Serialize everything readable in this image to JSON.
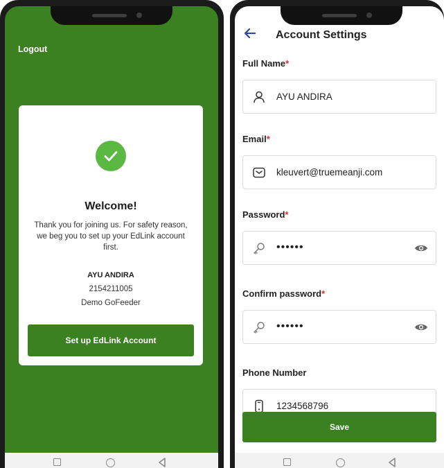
{
  "welcome_screen": {
    "logout_label": "Logout",
    "welcome_title": "Welcome!",
    "welcome_message": "Thank you for joining us. For safety reason, we beg you to set up your EdLink account first.",
    "user_name": "AYU ANDIRA",
    "user_id": "2154211005",
    "organization": "Demo GoFeeder",
    "setup_button": "Set up EdLink Account"
  },
  "account_settings": {
    "title": "Account Settings",
    "required_marker": "*",
    "fields": {
      "full_name": {
        "label": "Full Name",
        "value": "AYU ANDIRA",
        "icon": "user-icon"
      },
      "email": {
        "label": "Email",
        "value": "kleuvert@truemeanji.com",
        "icon": "mail-icon"
      },
      "password": {
        "label": "Password",
        "value": "••••••",
        "icon": "key-icon"
      },
      "confirm_password": {
        "label": "Confirm password",
        "value": "••••••",
        "icon": "key-icon"
      },
      "phone": {
        "label": "Phone Number",
        "value": "1234568796",
        "icon": "phone-icon"
      }
    },
    "save_button": "Save"
  },
  "colors": {
    "brand_green": "#3b8122",
    "success_green": "#5bb842",
    "required_red": "#d32f2f",
    "back_arrow_blue": "#2b4aa0"
  }
}
